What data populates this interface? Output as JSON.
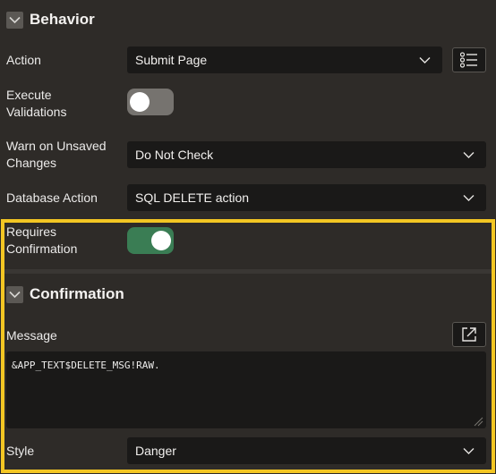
{
  "behavior": {
    "title": "Behavior",
    "action": {
      "label": "Action",
      "value": "Submit Page"
    },
    "execute_validations": {
      "label_line1": "Execute",
      "label_line2": "Validations",
      "state": "off"
    },
    "warn_unsaved": {
      "label_line1": "Warn on Unsaved",
      "label_line2": "Changes",
      "value": "Do Not Check"
    },
    "database_action": {
      "label": "Database Action",
      "value": "SQL DELETE action"
    },
    "requires_confirmation": {
      "label_line1": "Requires",
      "label_line2": "Confirmation",
      "state": "on"
    }
  },
  "confirmation": {
    "title": "Confirmation",
    "message": {
      "label": "Message",
      "value": "&APP_TEXT$DELETE_MSG!RAW."
    },
    "style": {
      "label": "Style",
      "value": "Danger"
    }
  },
  "icons": {
    "collapse": "chevron-down-icon",
    "list": "list-icon",
    "expand": "expand-icon",
    "select": "chevron-down-icon"
  },
  "colors": {
    "background": "#2e2b28",
    "field": "#1a1918",
    "highlight": "#f3c623",
    "toggle_on": "#3a7d54",
    "toggle_off": "#76736f"
  }
}
